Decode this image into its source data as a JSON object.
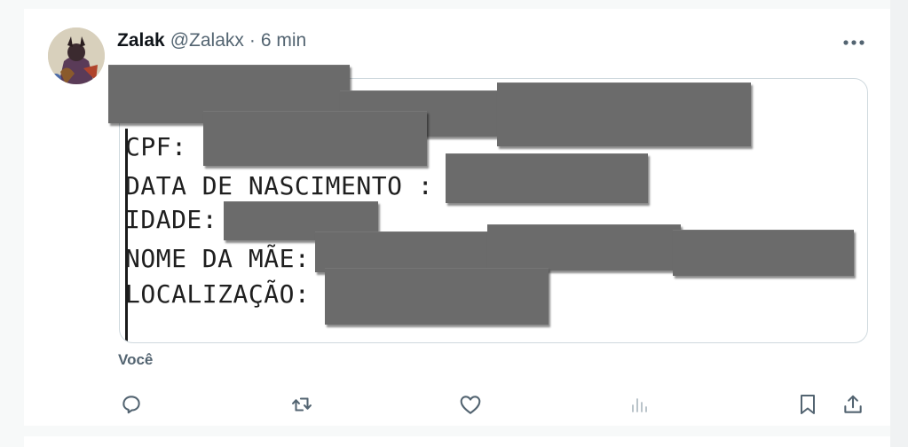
{
  "tweet": {
    "author_name": "Zalak",
    "author_handle": "@Zalakx",
    "separator": "·",
    "time": "6 min",
    "caption": "Você"
  },
  "media": {
    "lines": [
      {
        "label": "CPF:"
      },
      {
        "label": "DATA DE NASCIMENTO :"
      },
      {
        "label": "IDADE:"
      },
      {
        "label": "NOME DA MÃE:"
      },
      {
        "label": "LOCALIZAÇÃO:"
      }
    ],
    "redaction_color": "#6b6b6b"
  },
  "icons": {
    "more": "more-icon",
    "reply": "reply-icon",
    "retweet": "retweet-icon",
    "like": "like-icon",
    "views": "views-icon",
    "bookmark": "bookmark-icon",
    "share": "share-icon"
  },
  "colors": {
    "text_primary": "#0f1419",
    "text_secondary": "#536471",
    "border": "#cfd9de"
  }
}
